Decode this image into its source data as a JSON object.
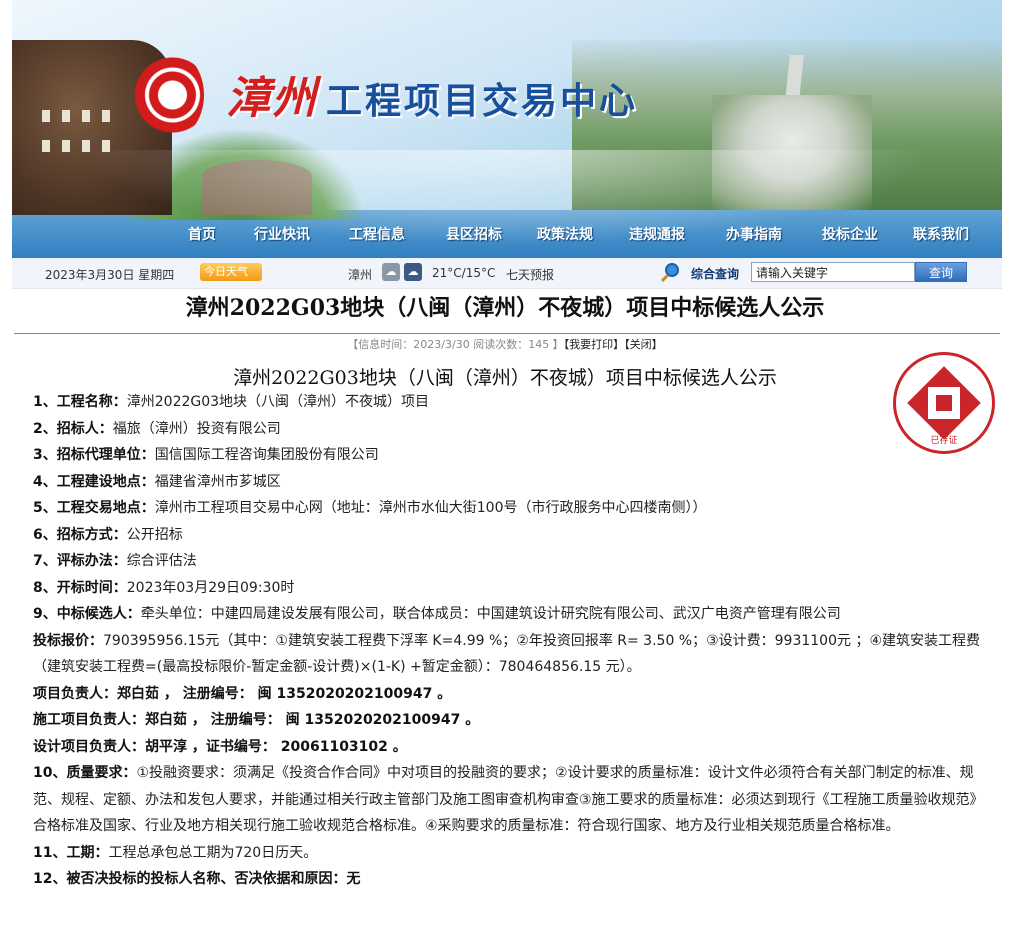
{
  "site": {
    "title_red": "漳州",
    "title_blue": "工程项目交易中心"
  },
  "nav": [
    "首页",
    "行业快讯",
    "工程信息",
    "县区招标",
    "政策法规",
    "违规通报",
    "办事指南",
    "投标企业",
    "联系我们"
  ],
  "infobar": {
    "date": "2023年3月30日 星期四",
    "weather_btn": "今日天气",
    "city": "漳州",
    "temp": "21°C/15°C",
    "forecast": "七天预报",
    "search_label": "综合查询",
    "search_placeholder": "请输入关键字",
    "search_btn": "查询"
  },
  "article": {
    "title": "漳州2022G03地块（八闽（漳州）不夜城）项目中标候选人公示",
    "meta": "【信息时间：2023/3/30  阅读次数：145 】",
    "print_link": "【我要打印】",
    "close_link": "【关闭】",
    "doc_title": "漳州2022G03地块（八闽（漳州）不夜城）项目中标候选人公示",
    "stamp_text": "已存证",
    "items": [
      {
        "k": "1、工程名称：",
        "v": "漳州2022G03地块（八闽（漳州）不夜城）项目"
      },
      {
        "k": "2、招标人：",
        "v": "福旅（漳州）投资有限公司"
      },
      {
        "k": "3、招标代理单位：",
        "v": "国信国际工程咨询集团股份有限公司"
      },
      {
        "k": "4、工程建设地点：",
        "v": "福建省漳州市芗城区"
      },
      {
        "k": "5、工程交易地点：",
        "v": "漳州市工程项目交易中心网（地址：漳州市水仙大街100号（市行政服务中心四楼南侧））"
      },
      {
        "k": "6、招标方式：",
        "v": "公开招标"
      },
      {
        "k": "7、评标办法：",
        "v": "综合评估法"
      },
      {
        "k": "8、开标时间：",
        "v": "2023年03月29日09:30时"
      },
      {
        "k": "9、中标候选人：",
        "v": "牵头单位：中建四局建设发展有限公司，联合体成员：中国建筑设计研究院有限公司、武汉广电资产管理有限公司"
      },
      {
        "k": "投标报价：",
        "v": "790395956.15元（其中：①建筑安装工程费下浮率 K=4.99 %；②年投资回报率 R= 3.50 %；③设计费：9931100元 ；④建筑安装工程费（建筑安装工程费=(最高投标限价-暂定金额-设计费)×(1-K) +暂定金额）：780464856.15 元）。"
      },
      {
        "k": "项目负责人：",
        "v": "郑白茹 ，  注册编号： 闽 1352020202100947 。"
      },
      {
        "k": "施工项目负责人：",
        "v": "郑白茹 ，  注册编号： 闽 1352020202100947 。"
      },
      {
        "k": "设计项目负责人：",
        "v": "胡平淳   ，证书编号： 20061103102 。"
      },
      {
        "k": "10、质量要求：",
        "v": "①投融资要求：须满足《投资合作合同》中对项目的投融资的要求；②设计要求的质量标准：设计文件必须符合有关部门制定的标准、规范、规程、定额、办法和发包人要求，并能通过相关行政主管部门及施工图审查机构审查③施工要求的质量标准：必须达到现行《工程施工质量验收规范》合格标准及国家、行业及地方相关现行施工验收规范合格标准。④采购要求的质量标准：符合现行国家、地方及行业相关规范质量合格标准。"
      },
      {
        "k": "11、工期：",
        "v": "工程总承包总工期为720日历天。"
      },
      {
        "k": "12、被否决投标的投标人名称、否决依据和原因：",
        "v": "无"
      }
    ]
  },
  "colors": {
    "accent_red": "#d41f1f",
    "brand_blue": "#184f9d"
  }
}
